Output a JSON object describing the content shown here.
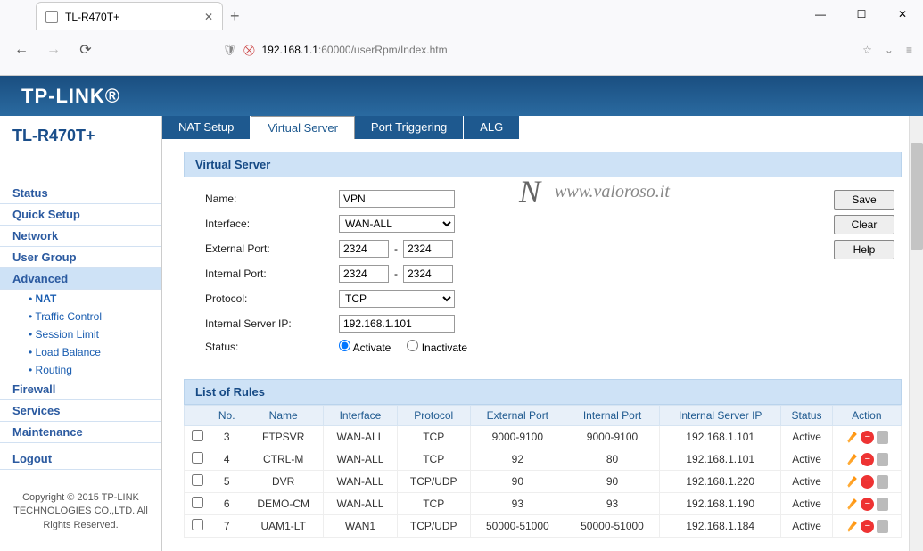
{
  "browser": {
    "tab_title": "TL-R470T+",
    "url_host": "192.168.1.1",
    "url_path": ":60000/userRpm/Index.htm"
  },
  "header": {
    "brand": "TP-LINK®"
  },
  "sidebar": {
    "model": "TL-R470T+",
    "items": [
      {
        "label": "Status"
      },
      {
        "label": "Quick Setup"
      },
      {
        "label": "Network"
      },
      {
        "label": "User Group"
      },
      {
        "label": "Advanced",
        "active": true,
        "sub": [
          {
            "label": "NAT",
            "active": true
          },
          {
            "label": "Traffic Control"
          },
          {
            "label": "Session Limit"
          },
          {
            "label": "Load Balance"
          },
          {
            "label": "Routing"
          }
        ]
      },
      {
        "label": "Firewall"
      },
      {
        "label": "Services"
      },
      {
        "label": "Maintenance"
      }
    ],
    "logout": "Logout",
    "copyright": "Copyright © 2015\nTP-LINK TECHNOLOGIES\nCO.,LTD. All Rights\nReserved."
  },
  "tabs": [
    {
      "label": "NAT Setup"
    },
    {
      "label": "Virtual Server",
      "active": true
    },
    {
      "label": "Port Triggering"
    },
    {
      "label": "ALG"
    }
  ],
  "panel": {
    "title": "Virtual Server",
    "form": {
      "name_label": "Name:",
      "name_value": "VPN",
      "interface_label": "Interface:",
      "interface_value": "WAN-ALL",
      "extport_label": "External Port:",
      "extport_from": "2324",
      "extport_to": "2324",
      "intport_label": "Internal Port:",
      "intport_from": "2324",
      "intport_to": "2324",
      "protocol_label": "Protocol:",
      "protocol_value": "TCP",
      "serverip_label": "Internal Server IP:",
      "serverip_value": "192.168.1.101",
      "status_label": "Status:",
      "status_activate": "Activate",
      "status_inactivate": "Inactivate",
      "dash": "-"
    },
    "buttons": {
      "save": "Save",
      "clear": "Clear",
      "help": "Help"
    },
    "watermark": "www.valoroso.it"
  },
  "list": {
    "title": "List of Rules",
    "headers": [
      "",
      "No.",
      "Name",
      "Interface",
      "Protocol",
      "External Port",
      "Internal Port",
      "Internal Server IP",
      "Status",
      "Action"
    ],
    "rows": [
      {
        "no": "3",
        "name": "FTPSVR",
        "iface": "WAN-ALL",
        "proto": "TCP",
        "ext": "9000-9100",
        "int": "9000-9100",
        "ip": "192.168.1.101",
        "status": "Active"
      },
      {
        "no": "4",
        "name": "CTRL-M",
        "iface": "WAN-ALL",
        "proto": "TCP",
        "ext": "92",
        "int": "80",
        "ip": "192.168.1.101",
        "status": "Active"
      },
      {
        "no": "5",
        "name": "DVR",
        "iface": "WAN-ALL",
        "proto": "TCP/UDP",
        "ext": "90",
        "int": "90",
        "ip": "192.168.1.220",
        "status": "Active"
      },
      {
        "no": "6",
        "name": "DEMO-CM",
        "iface": "WAN-ALL",
        "proto": "TCP",
        "ext": "93",
        "int": "93",
        "ip": "192.168.1.190",
        "status": "Active"
      },
      {
        "no": "7",
        "name": "UAM1-LT",
        "iface": "WAN1",
        "proto": "TCP/UDP",
        "ext": "50000-51000",
        "int": "50000-51000",
        "ip": "192.168.1.184",
        "status": "Active"
      }
    ]
  }
}
